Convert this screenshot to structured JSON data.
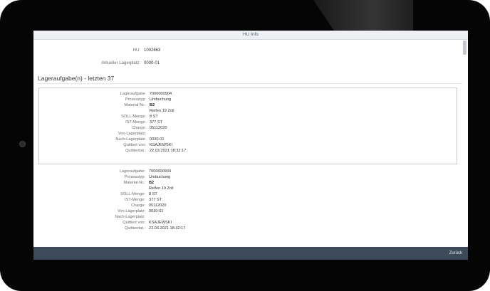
{
  "window": {
    "title": "HU Info"
  },
  "hu": {
    "label": "HU:",
    "value": "1002663"
  },
  "location": {
    "label": "Aktueller Lagerplatz:",
    "value": "0030-01"
  },
  "section": {
    "title": "Lageraufgabe(n) - letzten 37"
  },
  "tasks": [
    {
      "rows": [
        {
          "label": "Lageraufgabe:",
          "value": "7000000904",
          "bold": false
        },
        {
          "label": "Prozesstyp:",
          "value": "Umbuchung",
          "bold": false
        },
        {
          "label": "Material-Nr.:",
          "value": "B2",
          "bold": true
        },
        {
          "label": "",
          "value": "Reifen 19 Zoll",
          "bold": false
        },
        {
          "label": "SOLL-Menge:",
          "value": "8 ST",
          "bold": false
        },
        {
          "label": "IST-Menge:",
          "value": "377 ST",
          "bold": false
        },
        {
          "label": "Charge:",
          "value": "05112020",
          "bold": false
        },
        {
          "label": "Von-Lagerplatz:",
          "value": "",
          "bold": false
        },
        {
          "label": "Nach-Lagerplatz:",
          "value": "0030-01",
          "bold": false
        },
        {
          "label": "Quittiert von:",
          "value": "KSAJEWSKI",
          "bold": false
        },
        {
          "label": "Quittierdat.:",
          "value": "22.03.2021 18:32:17",
          "bold": false
        }
      ]
    },
    {
      "rows": [
        {
          "label": "Lageraufgabe:",
          "value": "7000000904",
          "bold": false
        },
        {
          "label": "Prozesstyp:",
          "value": "Umbuchung",
          "bold": false
        },
        {
          "label": "Material-Nr.:",
          "value": "B2",
          "bold": true
        },
        {
          "label": "",
          "value": "Reifen 19 Zoll",
          "bold": false
        },
        {
          "label": "SOLL-Menge:",
          "value": "8 ST",
          "bold": false
        },
        {
          "label": "IST-Menge:",
          "value": "377 ST",
          "bold": false
        },
        {
          "label": "Charge:",
          "value": "05112020",
          "bold": false
        },
        {
          "label": "Von-Lagerplatz:",
          "value": "0030-01",
          "bold": false
        },
        {
          "label": "Nach-Lagerplatz:",
          "value": "",
          "bold": false
        },
        {
          "label": "Quittiert von:",
          "value": "KSAJEWSKI",
          "bold": false
        },
        {
          "label": "Quittierdat.:",
          "value": "22.03.2021 18:32:17",
          "bold": false
        }
      ]
    }
  ],
  "footer": {
    "back_label": "Zurück"
  }
}
